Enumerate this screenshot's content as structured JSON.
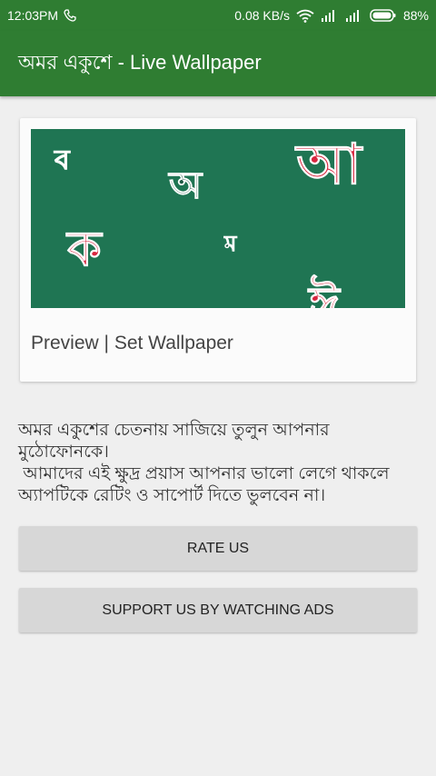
{
  "status_bar": {
    "time": "12:03PM",
    "network_speed": "0.08 KB/s",
    "battery": "88%"
  },
  "app_bar": {
    "title": "অমর একুশে - Live Wallpaper"
  },
  "preview_card": {
    "letters": [
      "ব",
      "অ",
      "আ",
      "ক",
      "ম",
      "ঈ"
    ],
    "action_label": "Preview | Set Wallpaper"
  },
  "description": {
    "line1": "অমর একুশের চেতনায় সাজিয়ে তুলুন আপনার মুঠোফোনকে।",
    "line2": " আমাদের এই ক্ষুদ্র প্রয়াস আপনার ভালো লেগে থাকলে অ্যাপটিকে রেটিং ও সাপোর্ট দিতে ভুলবেন না।"
  },
  "buttons": {
    "rate": "RATE US",
    "support": "SUPPORT US BY WATCHING ADS"
  },
  "colors": {
    "primary": "#2f7d32",
    "preview_bg": "#1f7553",
    "letter_red": "#d8263f"
  }
}
